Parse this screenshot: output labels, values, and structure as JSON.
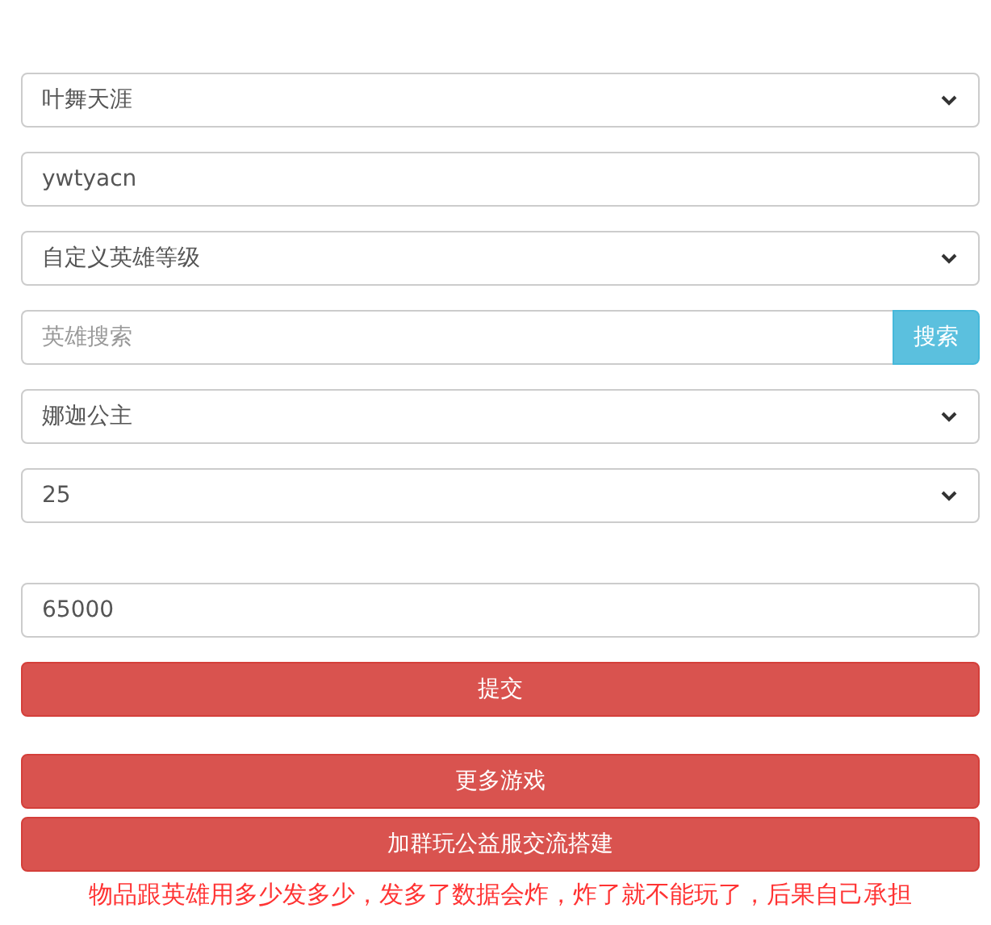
{
  "fields": [
    {
      "kind": "select",
      "value": "叶舞天涯"
    },
    {
      "kind": "input",
      "value": "ywtyacn"
    },
    {
      "kind": "select",
      "value": "自定义英雄等级"
    },
    {
      "kind": "search",
      "placeholder": "英雄搜索",
      "button": "搜索"
    },
    {
      "kind": "select",
      "value": "娜迦公主"
    },
    {
      "kind": "select",
      "value": "25"
    }
  ],
  "amount": {
    "value": "65000"
  },
  "submit": "提交",
  "links": [
    "更多游戏",
    "加群玩公益服交流搭建"
  ],
  "notice": "物品跟英雄用多少发多少，发多了数据会炸，炸了就不能玩了，后果自己承担"
}
